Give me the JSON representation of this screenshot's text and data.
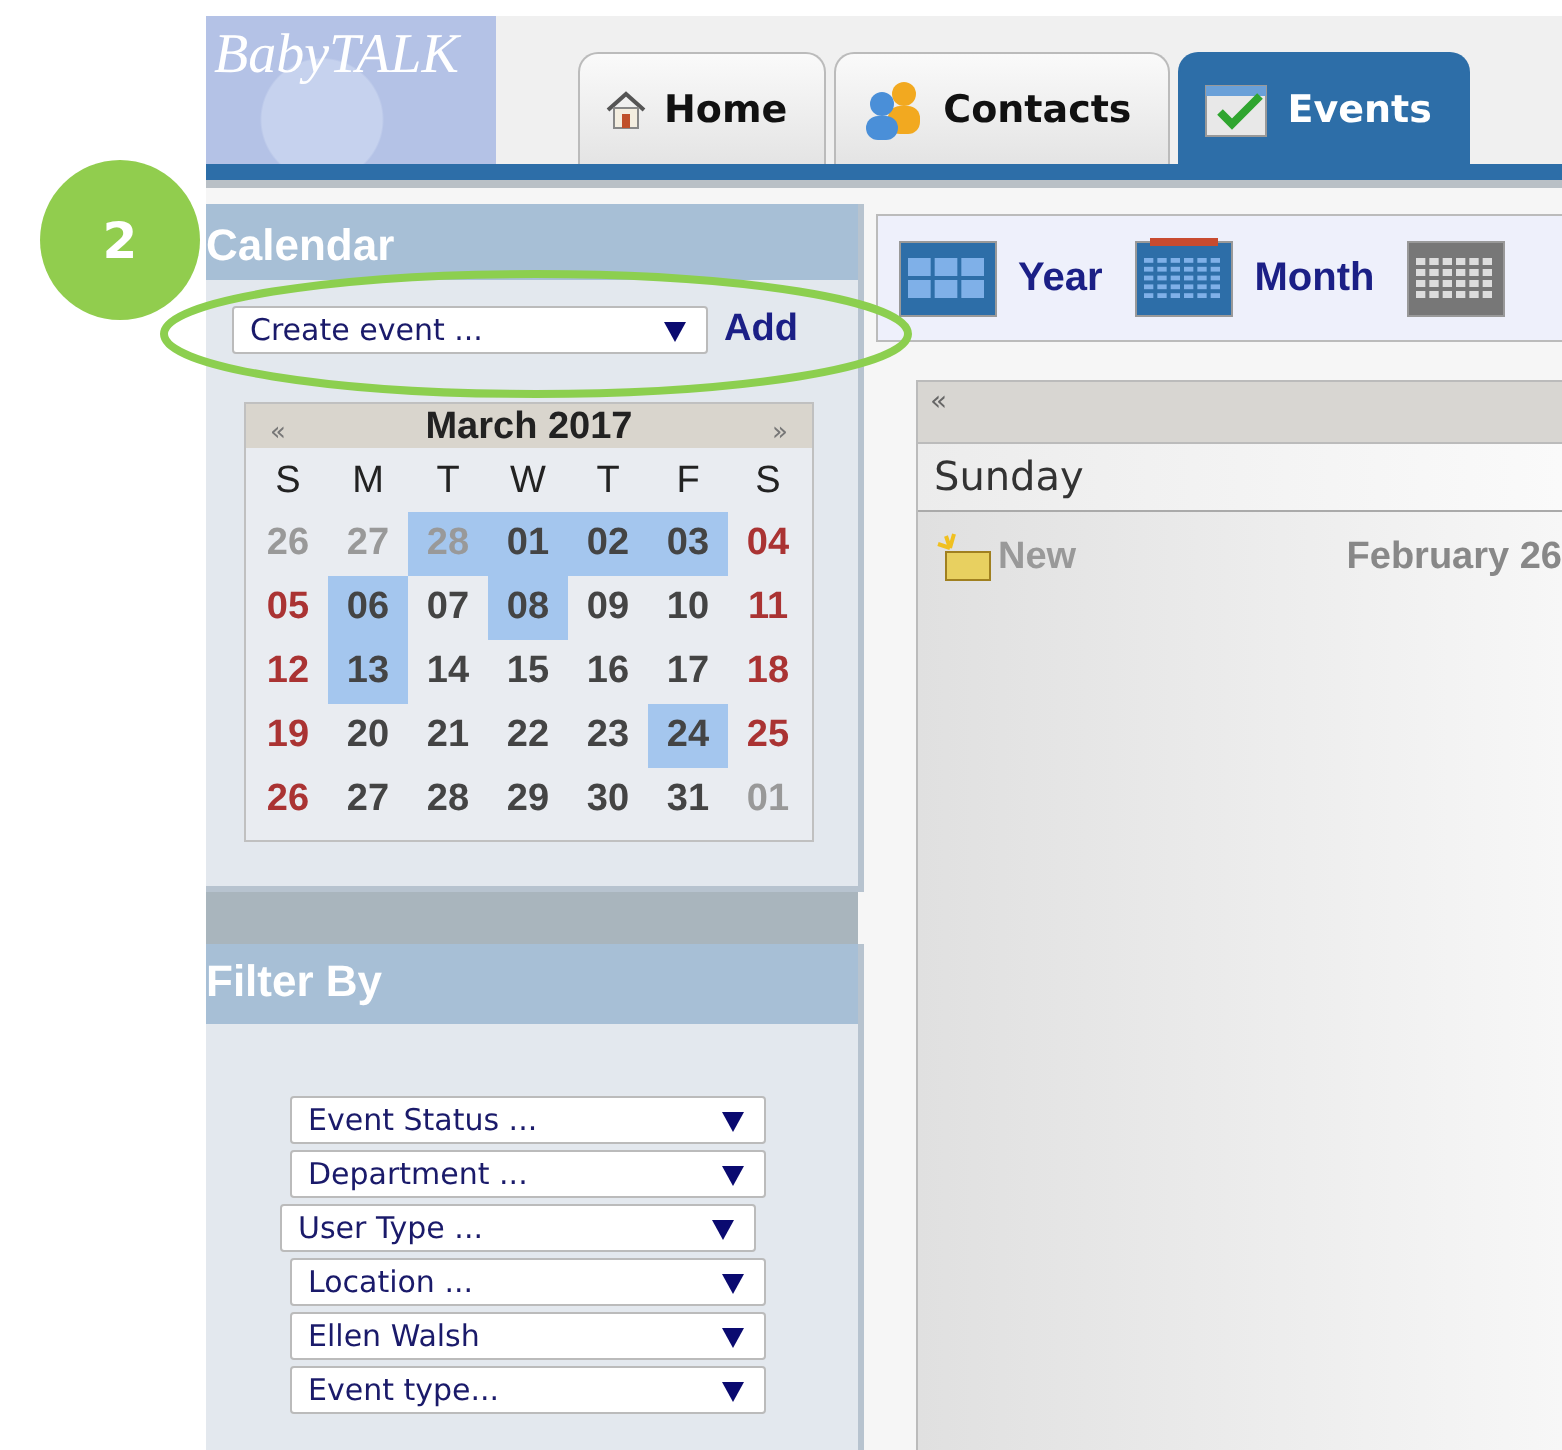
{
  "annotation": {
    "badge": "2"
  },
  "logo": {
    "text": "BabyTALK"
  },
  "tabs": [
    {
      "label": "Home",
      "selected": false
    },
    {
      "label": "Contacts",
      "selected": false
    },
    {
      "label": "Events",
      "selected": true
    }
  ],
  "calendar_panel": {
    "title": "Calendar",
    "create_select": "Create event ...",
    "add_link": "Add",
    "month": {
      "prev": "«",
      "title": "March 2017",
      "next": "»",
      "weekdays": [
        "S",
        "M",
        "T",
        "W",
        "T",
        "F",
        "S"
      ],
      "weeks": [
        [
          {
            "d": "26",
            "muted": true,
            "weekend": true,
            "marked": false
          },
          {
            "d": "27",
            "muted": true,
            "weekend": false,
            "marked": false
          },
          {
            "d": "28",
            "muted": true,
            "weekend": false,
            "marked": true
          },
          {
            "d": "01",
            "muted": false,
            "weekend": false,
            "marked": true
          },
          {
            "d": "02",
            "muted": false,
            "weekend": false,
            "marked": true
          },
          {
            "d": "03",
            "muted": false,
            "weekend": false,
            "marked": true
          },
          {
            "d": "04",
            "muted": false,
            "weekend": true,
            "marked": false
          }
        ],
        [
          {
            "d": "05",
            "muted": false,
            "weekend": true,
            "marked": false
          },
          {
            "d": "06",
            "muted": false,
            "weekend": false,
            "marked": true
          },
          {
            "d": "07",
            "muted": false,
            "weekend": false,
            "marked": false
          },
          {
            "d": "08",
            "muted": false,
            "weekend": false,
            "marked": true
          },
          {
            "d": "09",
            "muted": false,
            "weekend": false,
            "marked": false
          },
          {
            "d": "10",
            "muted": false,
            "weekend": false,
            "marked": false
          },
          {
            "d": "11",
            "muted": false,
            "weekend": true,
            "marked": false
          }
        ],
        [
          {
            "d": "12",
            "muted": false,
            "weekend": true,
            "marked": false
          },
          {
            "d": "13",
            "muted": false,
            "weekend": false,
            "marked": true
          },
          {
            "d": "14",
            "muted": false,
            "weekend": false,
            "marked": false
          },
          {
            "d": "15",
            "muted": false,
            "weekend": false,
            "marked": false
          },
          {
            "d": "16",
            "muted": false,
            "weekend": false,
            "marked": false
          },
          {
            "d": "17",
            "muted": false,
            "weekend": false,
            "marked": false
          },
          {
            "d": "18",
            "muted": false,
            "weekend": true,
            "marked": false
          }
        ],
        [
          {
            "d": "19",
            "muted": false,
            "weekend": true,
            "marked": false
          },
          {
            "d": "20",
            "muted": false,
            "weekend": false,
            "marked": false
          },
          {
            "d": "21",
            "muted": false,
            "weekend": false,
            "marked": false
          },
          {
            "d": "22",
            "muted": false,
            "weekend": false,
            "marked": false
          },
          {
            "d": "23",
            "muted": false,
            "weekend": false,
            "marked": false
          },
          {
            "d": "24",
            "muted": false,
            "weekend": false,
            "marked": true
          },
          {
            "d": "25",
            "muted": false,
            "weekend": true,
            "marked": false
          }
        ],
        [
          {
            "d": "26",
            "muted": false,
            "weekend": true,
            "marked": false
          },
          {
            "d": "27",
            "muted": false,
            "weekend": false,
            "marked": false
          },
          {
            "d": "28",
            "muted": false,
            "weekend": false,
            "marked": false
          },
          {
            "d": "29",
            "muted": false,
            "weekend": false,
            "marked": false
          },
          {
            "d": "30",
            "muted": false,
            "weekend": false,
            "marked": false
          },
          {
            "d": "31",
            "muted": false,
            "weekend": false,
            "marked": false
          },
          {
            "d": "01",
            "muted": true,
            "weekend": false,
            "marked": false
          }
        ]
      ]
    }
  },
  "filter_panel": {
    "title": "Filter By",
    "selects": [
      "Event Status ...",
      "Department ...",
      "User Type ...",
      "Location ...",
      "Ellen Walsh",
      "Event type..."
    ]
  },
  "views": [
    {
      "label": "Year",
      "kind": "year"
    },
    {
      "label": "Month",
      "kind": "month"
    },
    {
      "kind": "week"
    }
  ],
  "day_view": {
    "prev": "«",
    "day": "Sunday",
    "new_link": "New",
    "date": "February 26"
  }
}
